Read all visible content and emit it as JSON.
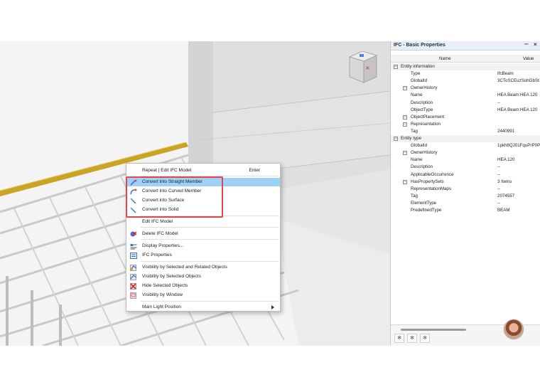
{
  "context_menu": {
    "items": [
      {
        "label": "Repeat | Edit IFC Model",
        "shortcut": "Enter",
        "icon": "none"
      },
      {
        "label": "Convert into Straight Member",
        "icon": "straight-member-icon",
        "highlighted": true
      },
      {
        "label": "Convert into Curved Member",
        "icon": "curved-member-icon"
      },
      {
        "label": "Convert into Surface",
        "icon": "surface-icon"
      },
      {
        "label": "Convert into Solid",
        "icon": "solid-icon"
      },
      {
        "label": "Edit IFC Model",
        "icon": "none"
      },
      {
        "label": "Delete IFC Model",
        "icon": "delete-icon"
      },
      {
        "label": "Display Properties...",
        "icon": "display-properties-icon"
      },
      {
        "label": "IFC Properties",
        "icon": "ifc-properties-icon"
      },
      {
        "label": "Visibility by Selected and Related Objects",
        "icon": "visibility-related-icon"
      },
      {
        "label": "Visibility by Selected Objects",
        "icon": "visibility-selected-icon"
      },
      {
        "label": "Hide Selected Objects",
        "icon": "hide-icon"
      },
      {
        "label": "Visibility by Window",
        "icon": "visibility-window-icon"
      },
      {
        "label": "Main Light Position",
        "icon": "none",
        "submenu": true
      }
    ]
  },
  "panel": {
    "title": "IFC - Basic Properties",
    "pin_icon": "pin-icon",
    "close_icon": "close-icon",
    "col_name": "Name",
    "col_value": "Value",
    "rows": [
      {
        "level": 0,
        "expander": "−",
        "name": "Entity information",
        "value": ""
      },
      {
        "level": 2,
        "name": "Type",
        "value": "IfcBeam"
      },
      {
        "level": 2,
        "name": "GlobalId",
        "value": "3CToSCEuzSohGbSt"
      },
      {
        "level": 1,
        "expander": "−",
        "name": "OwnerHistory",
        "value": ""
      },
      {
        "level": 2,
        "name": "Name",
        "value": "HEA Beam:HEA 120"
      },
      {
        "level": 2,
        "name": "Description",
        "value": "--"
      },
      {
        "level": 2,
        "name": "ObjectType",
        "value": "HEA Beam:HEA 120"
      },
      {
        "level": 1,
        "expander": "−",
        "name": "ObjectPlacement",
        "value": ""
      },
      {
        "level": 1,
        "expander": "−",
        "name": "Representation",
        "value": ""
      },
      {
        "level": 2,
        "name": "Tag",
        "value": "2440991"
      },
      {
        "level": 0,
        "expander": "−",
        "name": "Entity type",
        "value": ""
      },
      {
        "level": 2,
        "name": "GlobalId",
        "value": "1pkh8QJ01FquPrP0P"
      },
      {
        "level": 1,
        "expander": "−",
        "name": "OwnerHistory",
        "value": ""
      },
      {
        "level": 2,
        "name": "Name",
        "value": "HEA 120"
      },
      {
        "level": 2,
        "name": "Description",
        "value": "--"
      },
      {
        "level": 2,
        "name": "ApplicableOccurrence",
        "value": "--"
      },
      {
        "level": 1,
        "expander": "−",
        "name": "HasPropertySets",
        "value": "3 Items"
      },
      {
        "level": 2,
        "name": "RepresentationMaps",
        "value": "--"
      },
      {
        "level": 2,
        "name": "Tag",
        "value": "2074557"
      },
      {
        "level": 2,
        "name": "ElementType",
        "value": "--"
      },
      {
        "level": 2,
        "name": "PredefinedType",
        "value": "BEAM"
      }
    ],
    "tool_icons": [
      "filter-icon",
      "filter-related-icon",
      "filter-objects-icon"
    ]
  },
  "colors": {
    "highlight": "#9fd0f5",
    "callout": "#e0464f",
    "beam": "#c8a427"
  }
}
